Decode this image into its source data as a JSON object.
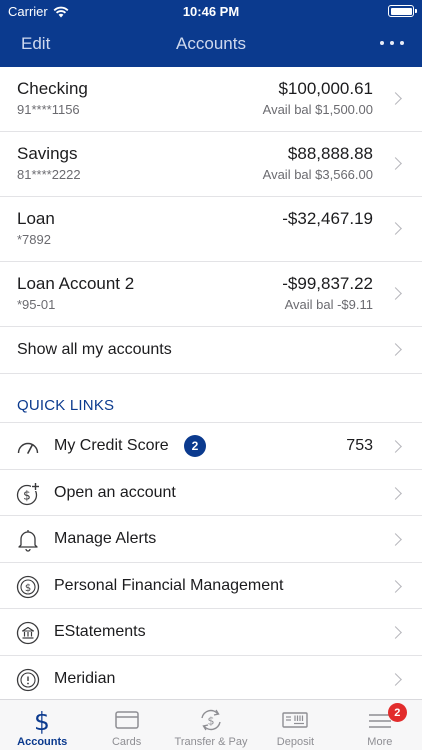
{
  "status_bar": {
    "carrier": "Carrier",
    "time": "10:46 PM"
  },
  "nav": {
    "edit_label": "Edit",
    "title": "Accounts"
  },
  "accounts": [
    {
      "name": "Checking",
      "number": "91****1156",
      "balance": "$100,000.61",
      "avail": "Avail bal $1,500.00"
    },
    {
      "name": "Savings",
      "number": "81****2222",
      "balance": "$88,888.88",
      "avail": "Avail bal $3,566.00"
    },
    {
      "name": "Loan",
      "number": "*7892",
      "balance": "-$32,467.19",
      "avail": ""
    },
    {
      "name": "Loan Account 2",
      "number": "*95-01",
      "balance": "-$99,837.22",
      "avail": "Avail bal -$9.11"
    }
  ],
  "show_all_label": "Show all my accounts",
  "quick_links": {
    "header": "QUICK LINKS",
    "items": [
      {
        "label": "My Credit Score",
        "badge": "2",
        "value": "753",
        "icon": "gauge-icon"
      },
      {
        "label": "Open an account",
        "icon": "dollar-plus-icon"
      },
      {
        "label": "Manage Alerts",
        "icon": "bell-icon"
      },
      {
        "label": "Personal Financial Management",
        "icon": "dollar-circle-icon"
      },
      {
        "label": "EStatements",
        "icon": "bank-icon"
      },
      {
        "label": "Meridian",
        "icon": "alert-circle-icon"
      }
    ]
  },
  "tabs": [
    {
      "label": "Accounts",
      "icon": "dollar-icon",
      "active": true
    },
    {
      "label": "Cards",
      "icon": "card-icon"
    },
    {
      "label": "Transfer & Pay",
      "icon": "transfer-icon"
    },
    {
      "label": "Deposit",
      "icon": "check-deposit-icon"
    },
    {
      "label": "More",
      "icon": "menu-icon",
      "badge": "2"
    }
  ],
  "colors": {
    "brand": "#0b3a8e",
    "badge_red": "#e22c2c",
    "text": "#1c1c1e",
    "secondary": "#6b6b70"
  }
}
